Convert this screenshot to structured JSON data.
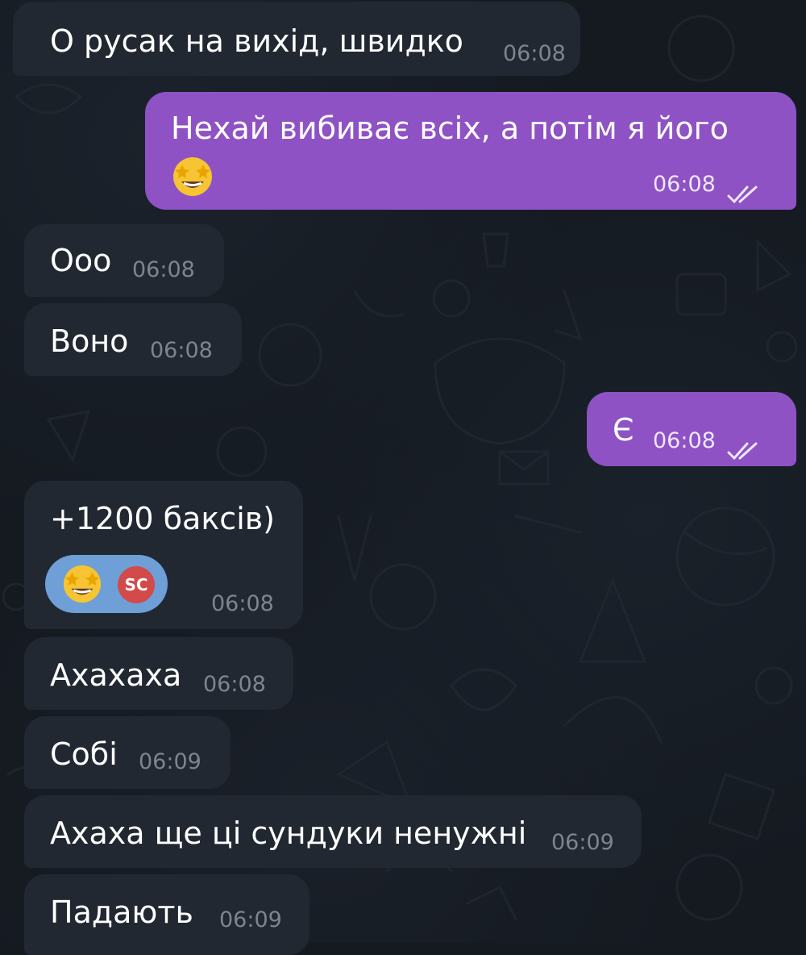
{
  "colors": {
    "background": "#151a21",
    "incoming_bubble": "#222831",
    "outgoing_bubble": "#8e52c5",
    "reaction_chip": "#6e9fd6",
    "avatar": "#d24a4a",
    "timestamp_incoming": "#7d8590"
  },
  "messages": [
    {
      "direction": "incoming",
      "text": "О русак на вихід, швидко",
      "time": "06:08"
    },
    {
      "direction": "outgoing",
      "text": "Нехай вибиває всіх, а потім я його",
      "emoji": "star-struck-emoji",
      "time": "06:08",
      "status": "read-double-check-icon"
    },
    {
      "direction": "incoming",
      "text": "Ооо",
      "time": "06:08"
    },
    {
      "direction": "incoming",
      "text": "Воно",
      "time": "06:08"
    },
    {
      "direction": "outgoing",
      "text": "Є",
      "time": "06:08",
      "status": "read-double-check-icon"
    },
    {
      "direction": "incoming",
      "text": "+1200 баксів)",
      "time": "06:08",
      "reaction": {
        "emoji": "star-struck-emoji",
        "avatar_initials": "SC"
      }
    },
    {
      "direction": "incoming",
      "text": "Ахахаха",
      "time": "06:08"
    },
    {
      "direction": "incoming",
      "text": "Собі",
      "time": "06:09"
    },
    {
      "direction": "incoming",
      "text": "Ахаха ще ці сундуки ненужні",
      "time": "06:09"
    },
    {
      "direction": "incoming",
      "text": "Падають",
      "time": "06:09"
    }
  ]
}
